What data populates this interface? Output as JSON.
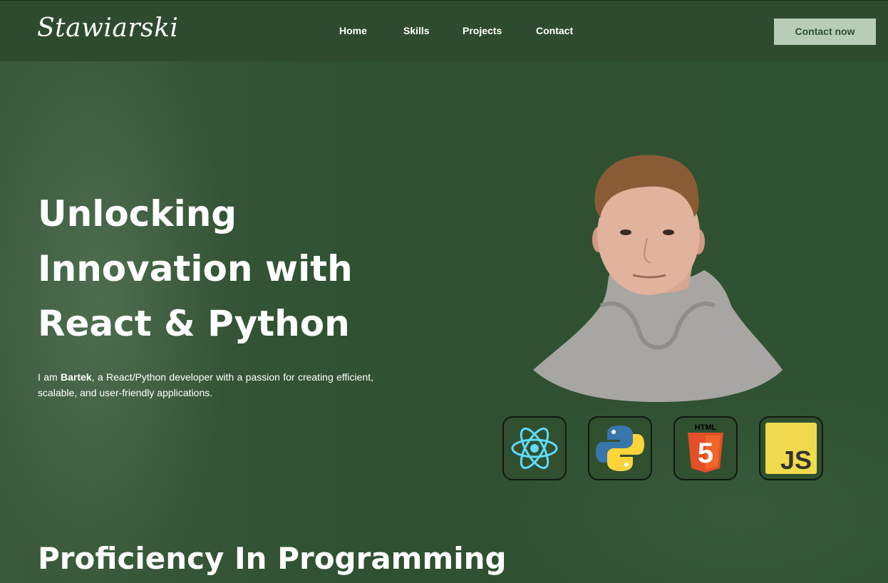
{
  "header": {
    "logo": "Stawiarski",
    "nav": [
      {
        "label": "Home"
      },
      {
        "label": "Skills"
      },
      {
        "label": "Projects"
      },
      {
        "label": "Contact"
      }
    ],
    "cta_label": "Contact now"
  },
  "hero": {
    "title_lines": [
      "Unlocking",
      "Innovation with",
      "React & Python"
    ],
    "desc_prefix": "I am ",
    "desc_name": "Bartek",
    "desc_rest": ", a React/Python developer with a passion for creating efficient, scalable, and user-friendly applications."
  },
  "tech_icons": [
    {
      "name": "react-icon",
      "color": "#61dafb"
    },
    {
      "name": "python-icon",
      "color": "#3776ab"
    },
    {
      "name": "html5-icon",
      "label": "HTML",
      "glyph": "5",
      "color": "#e34f26"
    },
    {
      "name": "javascript-icon",
      "label": "JS",
      "color": "#f0db4f"
    }
  ],
  "section": {
    "title": "Proficiency In Programming"
  },
  "colors": {
    "background": "#2f4f30",
    "header": "#2e4b2f",
    "cta_bg": "#b7cdb7",
    "text": "#ffffff"
  }
}
